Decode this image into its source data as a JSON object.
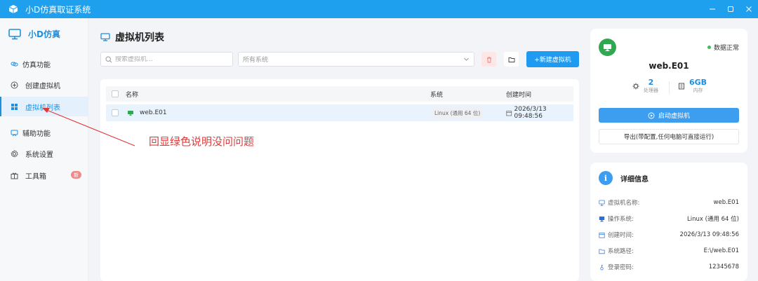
{
  "app": {
    "title": "小D仿真取证系统"
  },
  "sidebar": {
    "brand": "小D仿真",
    "items": [
      {
        "label": "仿真功能",
        "type": "group",
        "icon": "link-icon"
      },
      {
        "label": "创建虚拟机",
        "type": "item",
        "icon": "plus-circle-icon"
      },
      {
        "label": "虚拟机列表",
        "type": "item",
        "icon": "grid-icon",
        "active": true
      },
      {
        "label": "辅助功能",
        "type": "group",
        "icon": "tool-icon"
      },
      {
        "label": "系统设置",
        "type": "item",
        "icon": "gear-icon"
      },
      {
        "label": "工具箱",
        "type": "item",
        "icon": "gift-icon",
        "badge": "新"
      }
    ]
  },
  "main": {
    "title": "虚拟机列表",
    "search_placeholder": "搜索虚拟机...",
    "system_select": "所有系统",
    "new_button": "+新建虚拟机",
    "table": {
      "headers": [
        "名称",
        "系统",
        "创建时间"
      ],
      "rows": [
        {
          "name": "web.E01",
          "os": "Linux (通用 64 位)",
          "created": "2026/3/13 09:48:56"
        }
      ]
    }
  },
  "annotation": {
    "text": "回显绿色说明没问问题",
    "color": "#e03b3b"
  },
  "vm_card": {
    "name": "web.E01",
    "status": "数据正常",
    "cpu_value": "2",
    "cpu_label": "处理器",
    "mem_value": "6GB",
    "mem_label": "内存",
    "start_button": "启动虚拟机",
    "export_button": "导出(带配置,任何电脑可直接运行)"
  },
  "detail": {
    "title": "详细信息",
    "rows": [
      {
        "key": "虚拟机名称:",
        "value": "web.E01"
      },
      {
        "key": "操作系统:",
        "value": "Linux (通用 64 位)"
      },
      {
        "key": "创建时间:",
        "value": "2026/3/13 09:48:56"
      },
      {
        "key": "系统路径:",
        "value": "E:\\/web.E01"
      },
      {
        "key": "登录密码:",
        "value": "12345678"
      }
    ]
  },
  "colors": {
    "primary": "#1ea0ee",
    "accent": "#1e8fe0",
    "success": "#2fa84f",
    "danger": "#e03b3b"
  }
}
